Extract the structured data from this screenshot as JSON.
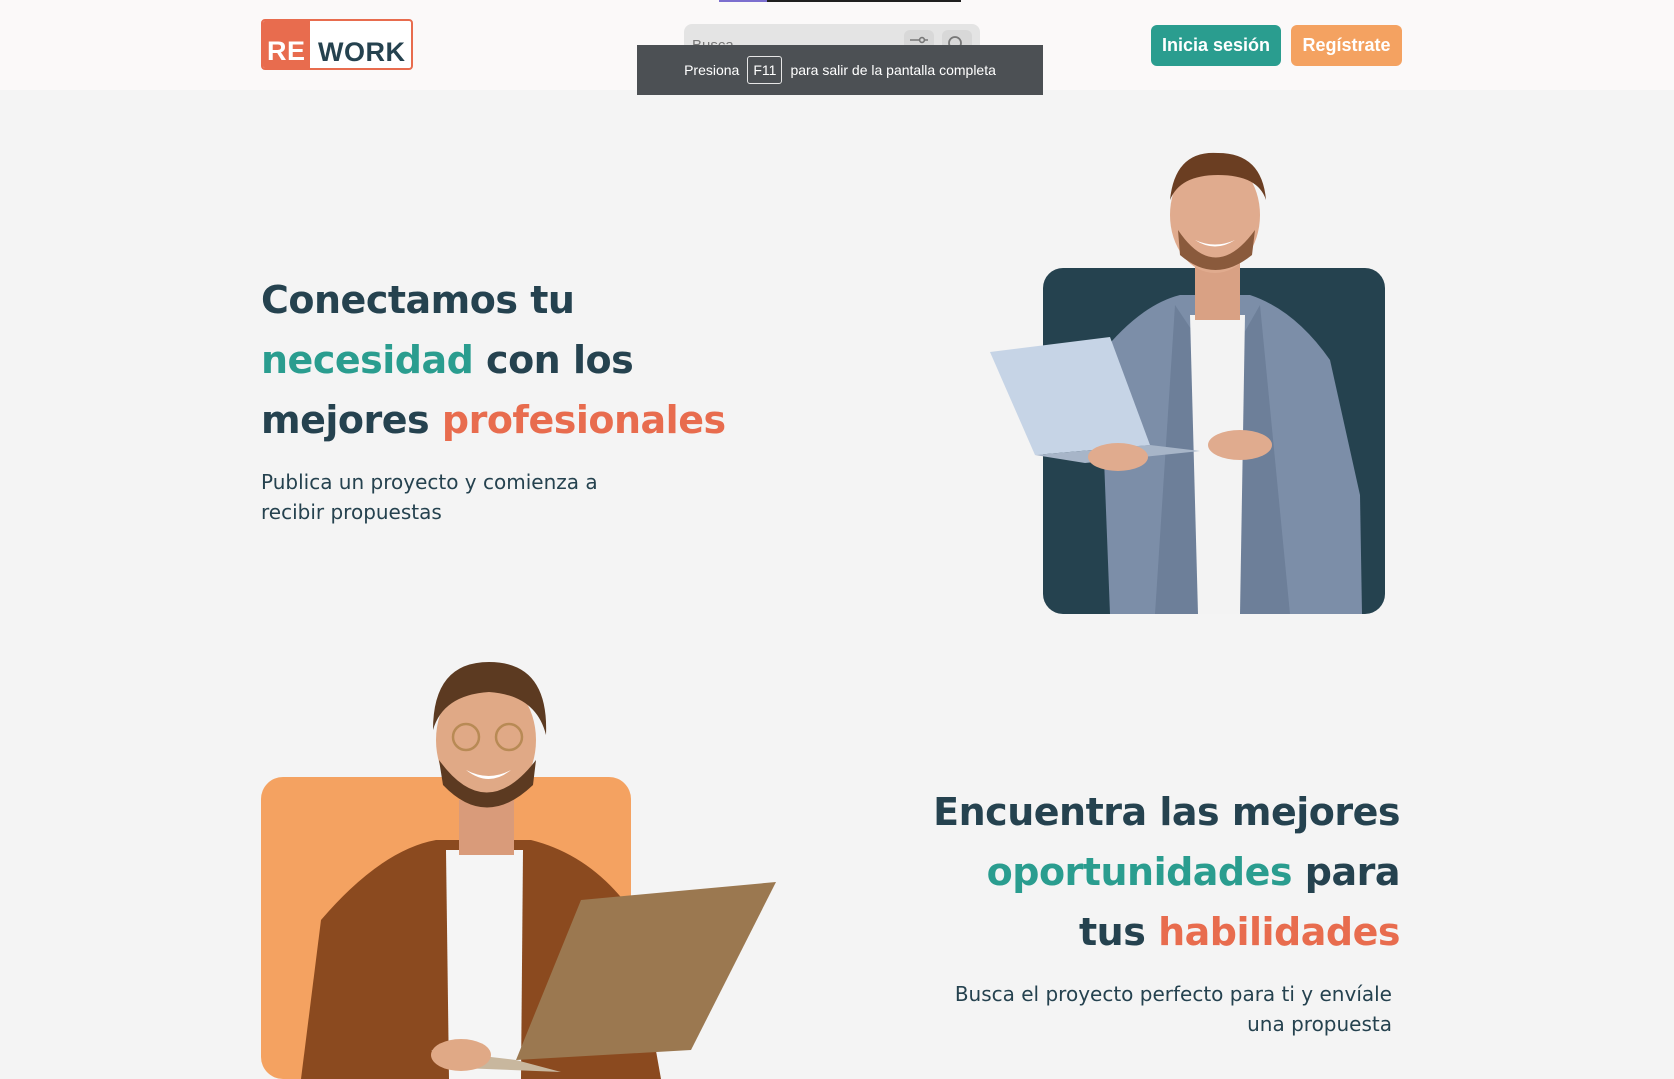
{
  "header": {
    "logo": {
      "part1": "RE",
      "part2": "WORK"
    },
    "search": {
      "placeholder": "Busca"
    },
    "fullscreen_toast": {
      "before": "Presiona",
      "key": "F11",
      "after": "para salir de la pantalla completa"
    },
    "login_label": "Inicia sesión",
    "register_label": "Regístrate"
  },
  "hero_clients": {
    "title_l1": "Conectamos tu",
    "title_l2_accent": "necesidad",
    "title_l2_rest": " con los",
    "title_l3_start": "mejores ",
    "title_l3_accent": "profesionales",
    "subtitle_l1": "Publica un proyecto y comienza a",
    "subtitle_l2": "recibir propuestas"
  },
  "hero_freelancers": {
    "title_l1": "Encuentra las mejores",
    "title_l2_accent": "oportunidades",
    "title_l2_rest": " para",
    "title_l3_start": "tus ",
    "title_l3_accent": "habilidades",
    "subtitle_l1": "Busca el proyecto perfecto para ti y envíale",
    "subtitle_l2": "una propuesta"
  },
  "colors": {
    "teal": "#2a9d8f",
    "orange": "#e86c4e",
    "light_orange": "#f4a261",
    "navy": "#25424f"
  }
}
